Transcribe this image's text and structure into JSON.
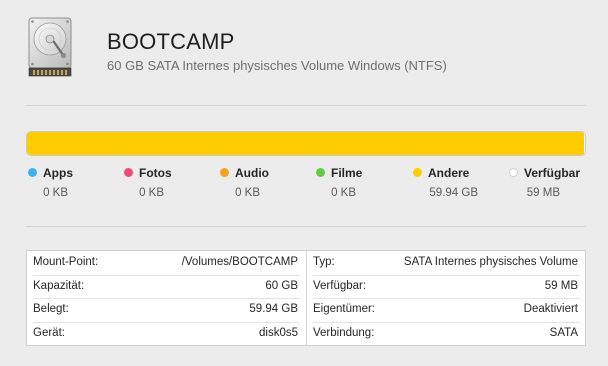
{
  "volume": {
    "name": "BOOTCAMP",
    "description": "60 GB SATA Internes physisches Volume Windows (NTFS)",
    "icon": "hard-disk-icon"
  },
  "usage": {
    "total_gb": 60,
    "segments": [
      {
        "category": "Andere",
        "fraction": 0.999,
        "color": "#ffcc00"
      },
      {
        "category": "Verfügbar",
        "fraction": 0.001,
        "color": "#ffffff"
      }
    ]
  },
  "legend": [
    {
      "label": "Apps",
      "value": "0 KB",
      "color": "#3ab3f0"
    },
    {
      "label": "Fotos",
      "value": "0 KB",
      "color": "#f5467a"
    },
    {
      "label": "Audio",
      "value": "0 KB",
      "color": "#f5a31a"
    },
    {
      "label": "Filme",
      "value": "0 KB",
      "color": "#62cd3b"
    },
    {
      "label": "Andere",
      "value": "59.94 GB",
      "color": "#ffcc00"
    },
    {
      "label": "Verfügbar",
      "value": "59 MB",
      "color": "#ffffff"
    }
  ],
  "info": {
    "left": [
      {
        "key": "Mount-Point:",
        "value": "/Volumes/BOOTCAMP"
      },
      {
        "key": "Kapazität:",
        "value": "60 GB"
      },
      {
        "key": "Belegt:",
        "value": "59.94 GB"
      },
      {
        "key": "Gerät:",
        "value": "disk0s5"
      }
    ],
    "right": [
      {
        "key": "Typ:",
        "value": "SATA Internes physisches Volume"
      },
      {
        "key": "Verfügbar:",
        "value": "59 MB"
      },
      {
        "key": "Eigentümer:",
        "value": "Deaktiviert"
      },
      {
        "key": "Verbindung:",
        "value": "SATA"
      }
    ]
  }
}
